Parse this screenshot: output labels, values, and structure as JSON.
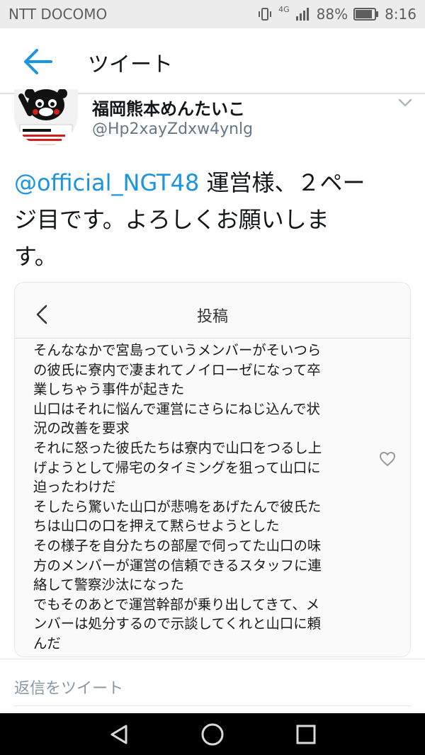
{
  "status_bar": {
    "carrier": "NTT DOCOMO",
    "network": "4G",
    "battery": "88%",
    "time": "8:16"
  },
  "header": {
    "title": "ツイート"
  },
  "tweet": {
    "display_name": "福岡熊本めんたいこ",
    "handle": "@Hp2xayZdxw4ynlg",
    "mention": "@official_NGT48",
    "text_line1": " 運営様、２ペー",
    "text_line2": "ジ目です。よろしくお願いしま",
    "text_line3": "す。"
  },
  "embedded_image": {
    "title": "投稿",
    "lines": [
      "そんななかで宮島っていうメンバーがそいつら",
      "の彼氏に寮内で凄まれてノイローゼになって卒",
      "業しちゃう事件が起きた",
      "山口はそれに悩んで運営にさらにねじ込んで状",
      "況の改善を要求",
      "それに怒った彼氏たちは寮内で山口をつるし上",
      "げようとして帰宅のタイミングを狙って山口に",
      "迫ったわけだ",
      "そしたら驚いた山口が悲鳴をあげたんで彼氏た",
      "ちは山口の口を押えて黙らせようとした",
      "その様子を自分たちの部屋で伺ってた山口の味",
      "方のメンバーが運営の信頼できるスタッフに連",
      "絡して警察沙汰になった",
      "でもそのあとで運営幹部が乗り出してきて、メ",
      "ンバーは処分するので示談してくれと山口に頼",
      "んだ"
    ]
  },
  "reply": {
    "placeholder": "返信をツイート"
  },
  "icons": {
    "back": "arrow-left-icon",
    "more": "chevron-down-icon",
    "heart": "heart-icon",
    "nav_back": "triangle-back-icon",
    "nav_home": "circle-home-icon",
    "nav_recents": "square-recents-icon"
  },
  "colors": {
    "accent": "#1b95e0",
    "secondary_text": "#657786"
  }
}
